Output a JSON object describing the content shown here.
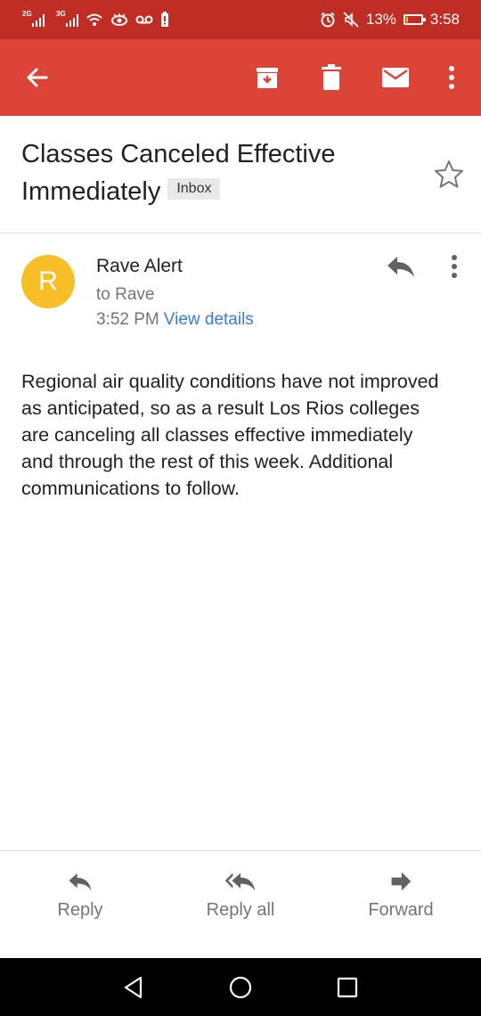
{
  "status_bar": {
    "net_1": "2G",
    "net_2": "3G",
    "battery_percent": "13%",
    "battery_level": 0.13,
    "time": "3:58",
    "icons": [
      "signal-icon",
      "wifi-icon",
      "eye-icon",
      "voicemail-icon",
      "battery-alert-icon",
      "alarm-icon",
      "mute-icon",
      "battery-icon"
    ]
  },
  "app_bar": {
    "color": "#db4437",
    "icons": [
      "back-arrow-icon",
      "archive-icon",
      "delete-icon",
      "mail-icon",
      "more-vert-icon"
    ]
  },
  "email": {
    "subject": "Classes Canceled Effective Immediately",
    "label": "Inbox",
    "sender_initial": "R",
    "sender_name": "Rave Alert",
    "recipient": "to Rave",
    "time": "3:52 PM",
    "details_link": "View details",
    "body": "Regional air quality conditions have not improved as anticipated, so as a result Los Rios colleges are canceling all classes effective immediately and through the rest of this week. Additional communications to follow."
  },
  "actions": {
    "reply": "Reply",
    "reply_all": "Reply all",
    "forward": "Forward"
  }
}
